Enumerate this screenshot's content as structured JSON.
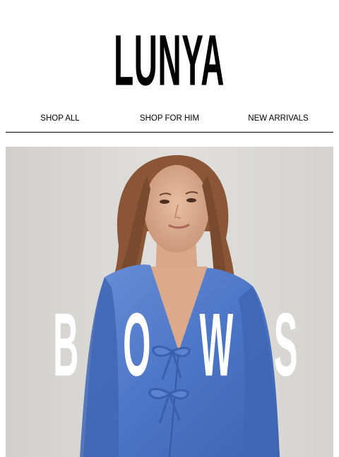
{
  "brand": {
    "logo_text": "LUNYA"
  },
  "nav": {
    "items": [
      {
        "label": "SHOP ALL"
      },
      {
        "label": "SHOP FOR HIM"
      },
      {
        "label": "NEW ARRIVALS"
      }
    ]
  },
  "hero": {
    "headline_letters": [
      "B",
      "O",
      "W",
      "S"
    ],
    "colors": {
      "background": "#d9d8d4",
      "garment": "#4f78c8",
      "headline": "#ffffff"
    }
  }
}
